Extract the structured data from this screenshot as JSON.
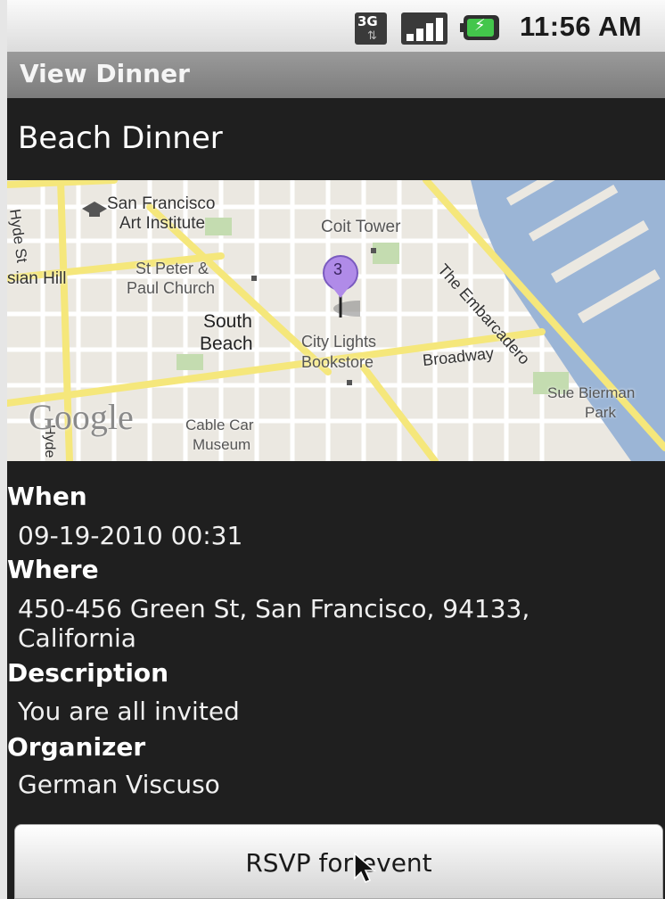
{
  "status_bar": {
    "network_label": "3G",
    "network_arrows": "⇅",
    "battery_bolt": "⚡",
    "time": "11:56 AM",
    "icons": [
      "signal-3g-icon",
      "signal-bars-icon",
      "battery-icon"
    ]
  },
  "app": {
    "title": "View Dinner"
  },
  "dinner": {
    "title": "Beach Dinner",
    "when_label": "When",
    "when": "09-19-2010 00:31",
    "where_label": "Where",
    "where": "450-456 Green St, San Francisco, 94133, California",
    "description_label": "Description",
    "description": "You are all invited",
    "organizer_label": "Organizer",
    "organizer": "German Viscuso"
  },
  "map": {
    "labels": {
      "art_institute_1": "San Francisco",
      "art_institute_2": "Art Institute",
      "coit_tower": "Coit Tower",
      "embarcadero": "The Embarcadero",
      "hyde_st": "Hyde St",
      "russian_hill": "sian Hill",
      "st_peter_1": "St Peter &",
      "st_peter_2": "Paul Church",
      "south_beach_1": "South",
      "south_beach_2": "Beach",
      "city_lights_1": "City Lights",
      "city_lights_2": "Bookstore",
      "broadway": "Broadway",
      "sue_bierman_1": "Sue Bierman",
      "sue_bierman_2": "Park",
      "cable_car_1": "Cable Car",
      "cable_car_2": "Museum",
      "google_logo": "Google",
      "hyde_lower": "Hyde"
    },
    "marker_label": "3",
    "colors": {
      "land": "#ebe8e1",
      "water": "#9bb5d6",
      "major_road": "#f5e77b",
      "park": "#c4dcb0",
      "marker": "#b08be8"
    }
  },
  "actions": {
    "rsvp_label": "RSVP for event"
  }
}
